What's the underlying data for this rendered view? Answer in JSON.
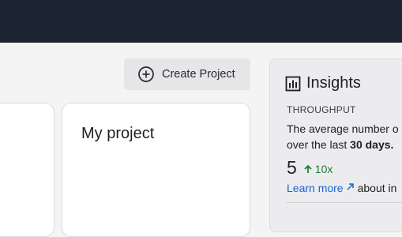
{
  "toolbar": {
    "create_project_label": "Create Project",
    "create_project_icon": "plus-circle-icon"
  },
  "projects": [
    {
      "title": ""
    },
    {
      "title": "My project"
    }
  ],
  "insights": {
    "icon": "bar-chart-icon",
    "title": "Insights",
    "section_label": "THROUGHPUT",
    "desc_line1": "The average number o",
    "desc_line2_prefix": "over the last ",
    "desc_line2_bold": "30 days.",
    "value": "5",
    "change": "10x",
    "change_icon": "arrow-up-icon",
    "change_color": "#1f7a3a",
    "learn_more_label": "Learn more",
    "learn_more_icon": "external-link-icon",
    "learn_more_suffix": "about in",
    "link_color": "#1a63d6"
  },
  "colors": {
    "topbar": "#1d2532",
    "background": "#f4f4f5",
    "button_bg": "#e6e6e8"
  }
}
